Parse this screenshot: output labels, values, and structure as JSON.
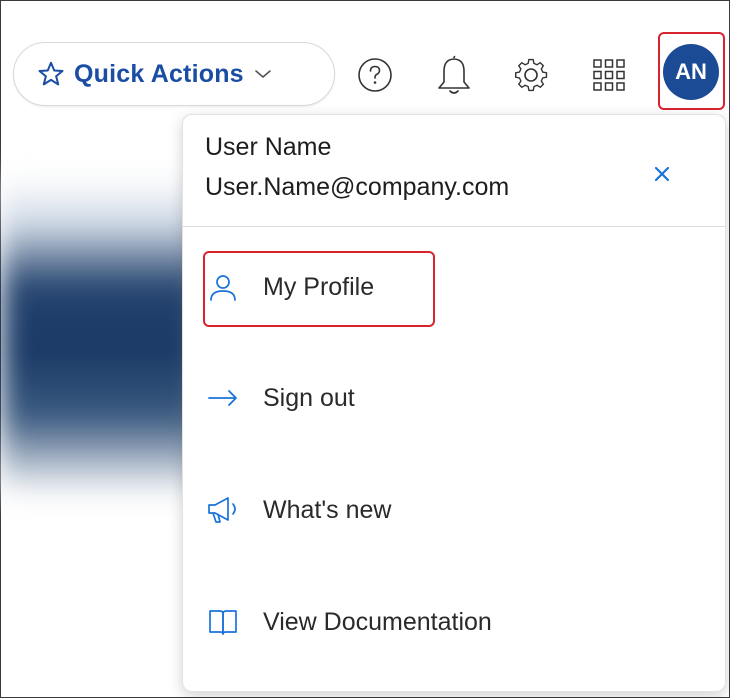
{
  "topbar": {
    "quick_actions_label": "Quick Actions",
    "icons": [
      "star-icon",
      "chevron-down-icon",
      "help-icon",
      "bell-icon",
      "gear-icon",
      "apps-grid-icon"
    ],
    "avatar_initials": "AN"
  },
  "dropdown": {
    "user_name": "User Name",
    "user_email": "User.Name@company.com",
    "items": [
      {
        "label": "My Profile",
        "icon": "user-icon"
      },
      {
        "label": "Sign out",
        "icon": "arrow-right-icon"
      },
      {
        "label": "What's new",
        "icon": "megaphone-icon"
      },
      {
        "label": "View Documentation",
        "icon": "book-icon"
      }
    ]
  },
  "colors": {
    "accent": "#1a4da3",
    "avatar_bg": "#1c4b96",
    "highlight": "#d9242f",
    "close": "#1a73d9"
  }
}
